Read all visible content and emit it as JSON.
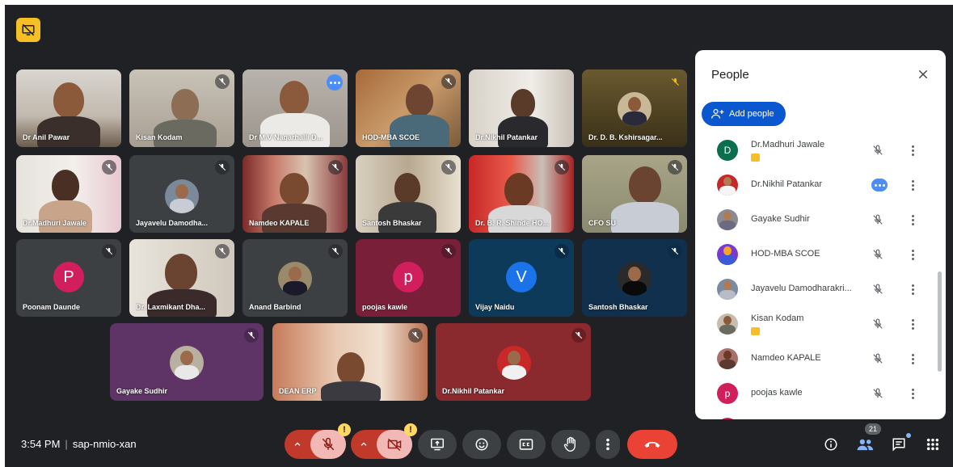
{
  "meeting": {
    "time": "3:54 PM",
    "separator": "|",
    "code": "sap-nmio-xan"
  },
  "tiles": [
    {
      "name": "Dr Anil Pawar"
    },
    {
      "name": "Kisan Kodam"
    },
    {
      "name": "Dr M.V Nagarhalli D..."
    },
    {
      "name": "HOD-MBA SCOE"
    },
    {
      "name": "Dr.Nikhil Patankar"
    },
    {
      "name": "Dr. D. B. Kshirsagar..."
    },
    {
      "name": "Dr.Madhuri Jawale"
    },
    {
      "name": "Jayavelu Damodha..."
    },
    {
      "name": "Namdeo KAPALE"
    },
    {
      "name": "Santosh Bhaskar"
    },
    {
      "name": "Dr. B. R. Shinde HO..."
    },
    {
      "name": "CFO SU"
    },
    {
      "name": "Poonam Daunde",
      "letter": "P"
    },
    {
      "name": "Dr. Laxmikant Dha..."
    },
    {
      "name": "Anand Barbind"
    },
    {
      "name": "poojas kawle",
      "letter": "p"
    },
    {
      "name": "Vijay Naidu",
      "letter": "V"
    },
    {
      "name": "Santosh Bhaskar"
    },
    {
      "name": "Gayake Sudhir"
    },
    {
      "name": "DEAN ERP"
    },
    {
      "name": "Dr.Nikhil Patankar"
    }
  ],
  "people_panel": {
    "title": "People",
    "add_label": "Add people",
    "participants": [
      {
        "name": "Dr.Madhuri Jawale",
        "avatar_letter": "D"
      },
      {
        "name": "Dr.Nikhil Patankar"
      },
      {
        "name": "Gayake Sudhir"
      },
      {
        "name": "HOD-MBA SCOE"
      },
      {
        "name": "Jayavelu Damodharakri..."
      },
      {
        "name": "Kisan Kodam"
      },
      {
        "name": "Namdeo KAPALE"
      },
      {
        "name": "poojas kawle",
        "avatar_letter": "p"
      }
    ]
  },
  "controls": {
    "warning_mark": "!",
    "participant_count": "21"
  },
  "colors": {
    "background": "#202124",
    "panel": "#ffffff",
    "accent_blue": "#0b57d0",
    "end_call_red": "#ea4335",
    "warning_yellow": "#fdd663"
  },
  "icons": [
    "presentation-off-icon",
    "mic-off-icon",
    "camera-off-icon",
    "present-icon",
    "emoji-icon",
    "captions-icon",
    "raise-hand-icon",
    "more-options-icon",
    "end-call-icon",
    "info-icon",
    "people-icon",
    "chat-icon",
    "activities-icon",
    "add-person-icon",
    "close-icon"
  ]
}
